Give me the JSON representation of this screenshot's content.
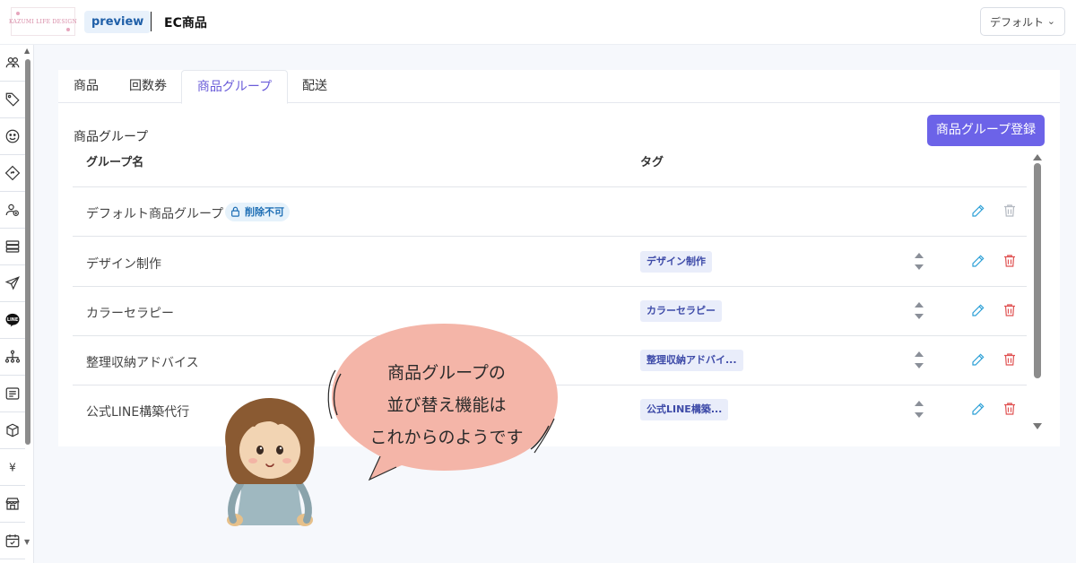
{
  "header": {
    "logo_text": "KAZUMI LIFE DESIGN",
    "env_badge": "preview",
    "title": "EC商品",
    "selector_value": "デフォルト",
    "selector_icon": "chevron-down-icon"
  },
  "sidebar": {
    "items": [
      {
        "icon": "users-icon"
      },
      {
        "icon": "tag-icon"
      },
      {
        "icon": "smile-icon"
      },
      {
        "icon": "diamond-icon"
      },
      {
        "icon": "user-add-icon"
      },
      {
        "icon": "list-icon"
      },
      {
        "icon": "send-icon"
      },
      {
        "icon": "line-icon",
        "label": "LINE"
      },
      {
        "icon": "sitemap-icon"
      },
      {
        "icon": "document-icon"
      },
      {
        "icon": "box-icon"
      },
      {
        "icon": "yen-icon",
        "label": "¥"
      },
      {
        "icon": "store-icon"
      },
      {
        "icon": "calendar-check-icon"
      }
    ]
  },
  "tabs": [
    {
      "label": "商品",
      "active": false
    },
    {
      "label": "回数券",
      "active": false
    },
    {
      "label": "商品グループ",
      "active": true
    },
    {
      "label": "配送",
      "active": false
    }
  ],
  "section": {
    "title": "商品グループ",
    "register_button": "商品グループ登録"
  },
  "table": {
    "columns": [
      "グループ名",
      "タグ"
    ],
    "rows": [
      {
        "name": "デフォルト商品グループ",
        "badge": "削除不可",
        "tag": "",
        "sortable": false,
        "deletable": false
      },
      {
        "name": "デザイン制作",
        "tag": "デザイン制作",
        "sortable": true,
        "deletable": true
      },
      {
        "name": "カラーセラピー",
        "tag": "カラーセラピー",
        "sortable": true,
        "deletable": true
      },
      {
        "name": "整理収納アドバイス",
        "tag": "整理収納アドバイ...",
        "sortable": true,
        "deletable": true
      },
      {
        "name": "公式LINE構築代行",
        "tag": "公式LINE構築...",
        "sortable": true,
        "deletable": true
      }
    ]
  },
  "bubble": {
    "line1": "商品グループの",
    "line2": "並び替え機能は",
    "line3": "これからのようです"
  },
  "colors": {
    "accent": "#6c63e8",
    "edit": "#2a9fd6",
    "delete": "#e05252",
    "delete_disabled": "#b5bac2",
    "bubble": "#f4b5a8"
  }
}
